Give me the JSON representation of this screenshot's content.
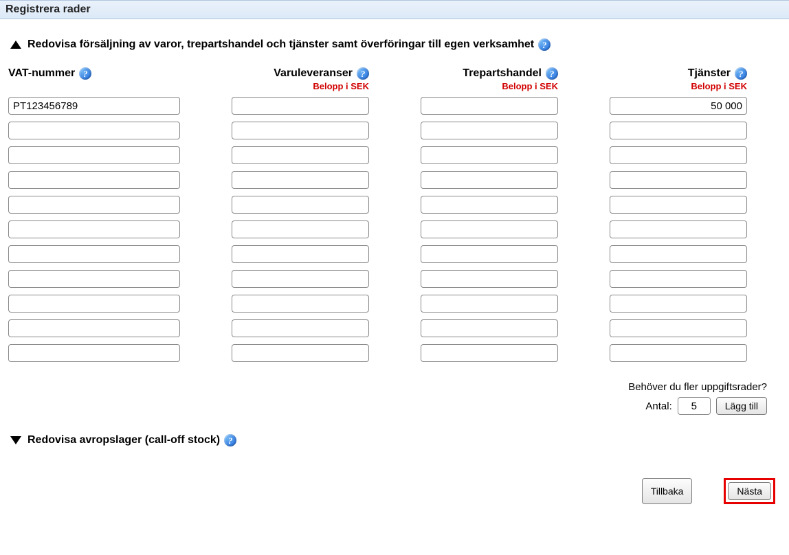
{
  "header": {
    "title": "Registrera rader"
  },
  "section1": {
    "title": "Redovisa försäljning av varor, trepartshandel och tjänster samt överföringar till egen verksamhet",
    "expanded": true,
    "columns": {
      "vat": {
        "label": "VAT-nummer",
        "sub": ""
      },
      "goods": {
        "label": "Varuleveranser",
        "sub": "Belopp i SEK"
      },
      "triangular": {
        "label": "Trepartshandel",
        "sub": "Belopp i SEK"
      },
      "services": {
        "label": "Tjänster",
        "sub": "Belopp i SEK"
      }
    },
    "rows": [
      {
        "vat": "PT123456789",
        "goods": "",
        "triangular": "",
        "services": "50 000"
      },
      {
        "vat": "",
        "goods": "",
        "triangular": "",
        "services": ""
      },
      {
        "vat": "",
        "goods": "",
        "triangular": "",
        "services": ""
      },
      {
        "vat": "",
        "goods": "",
        "triangular": "",
        "services": ""
      },
      {
        "vat": "",
        "goods": "",
        "triangular": "",
        "services": ""
      },
      {
        "vat": "",
        "goods": "",
        "triangular": "",
        "services": ""
      },
      {
        "vat": "",
        "goods": "",
        "triangular": "",
        "services": ""
      },
      {
        "vat": "",
        "goods": "",
        "triangular": "",
        "services": ""
      },
      {
        "vat": "",
        "goods": "",
        "triangular": "",
        "services": ""
      },
      {
        "vat": "",
        "goods": "",
        "triangular": "",
        "services": ""
      },
      {
        "vat": "",
        "goods": "",
        "triangular": "",
        "services": ""
      }
    ],
    "addRows": {
      "question": "Behöver du fler uppgiftsrader?",
      "countLabel": "Antal:",
      "countValue": "5",
      "buttonLabel": "Lägg till"
    }
  },
  "section2": {
    "title": "Redovisa avropslager (call-off stock)",
    "expanded": false
  },
  "nav": {
    "back": "Tillbaka",
    "next": "Nästa"
  }
}
